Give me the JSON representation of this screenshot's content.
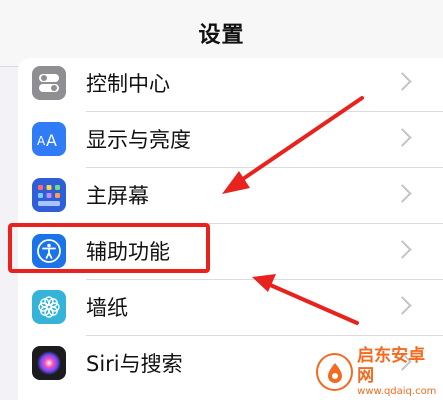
{
  "header": {
    "title": "设置"
  },
  "settings": {
    "items": [
      {
        "label": "控制中心",
        "icon": "control-center-icon"
      },
      {
        "label": "显示与亮度",
        "icon": "display-brightness-icon"
      },
      {
        "label": "主屏幕",
        "icon": "home-screen-icon"
      },
      {
        "label": "辅助功能",
        "icon": "accessibility-icon"
      },
      {
        "label": "墙纸",
        "icon": "wallpaper-icon"
      },
      {
        "label": "Siri与搜索",
        "icon": "siri-icon"
      }
    ]
  },
  "watermark": {
    "name": "启东安卓网",
    "url": "www.qdaiq.com"
  },
  "colors": {
    "annotation": "#e8231d",
    "control_center": "#8e8e93",
    "display": "#2f7cf6",
    "home_screen": "#2f5fd8",
    "accessibility": "#1a73e8",
    "wallpaper": "#36b3d9",
    "watermark": "#f26b21"
  }
}
